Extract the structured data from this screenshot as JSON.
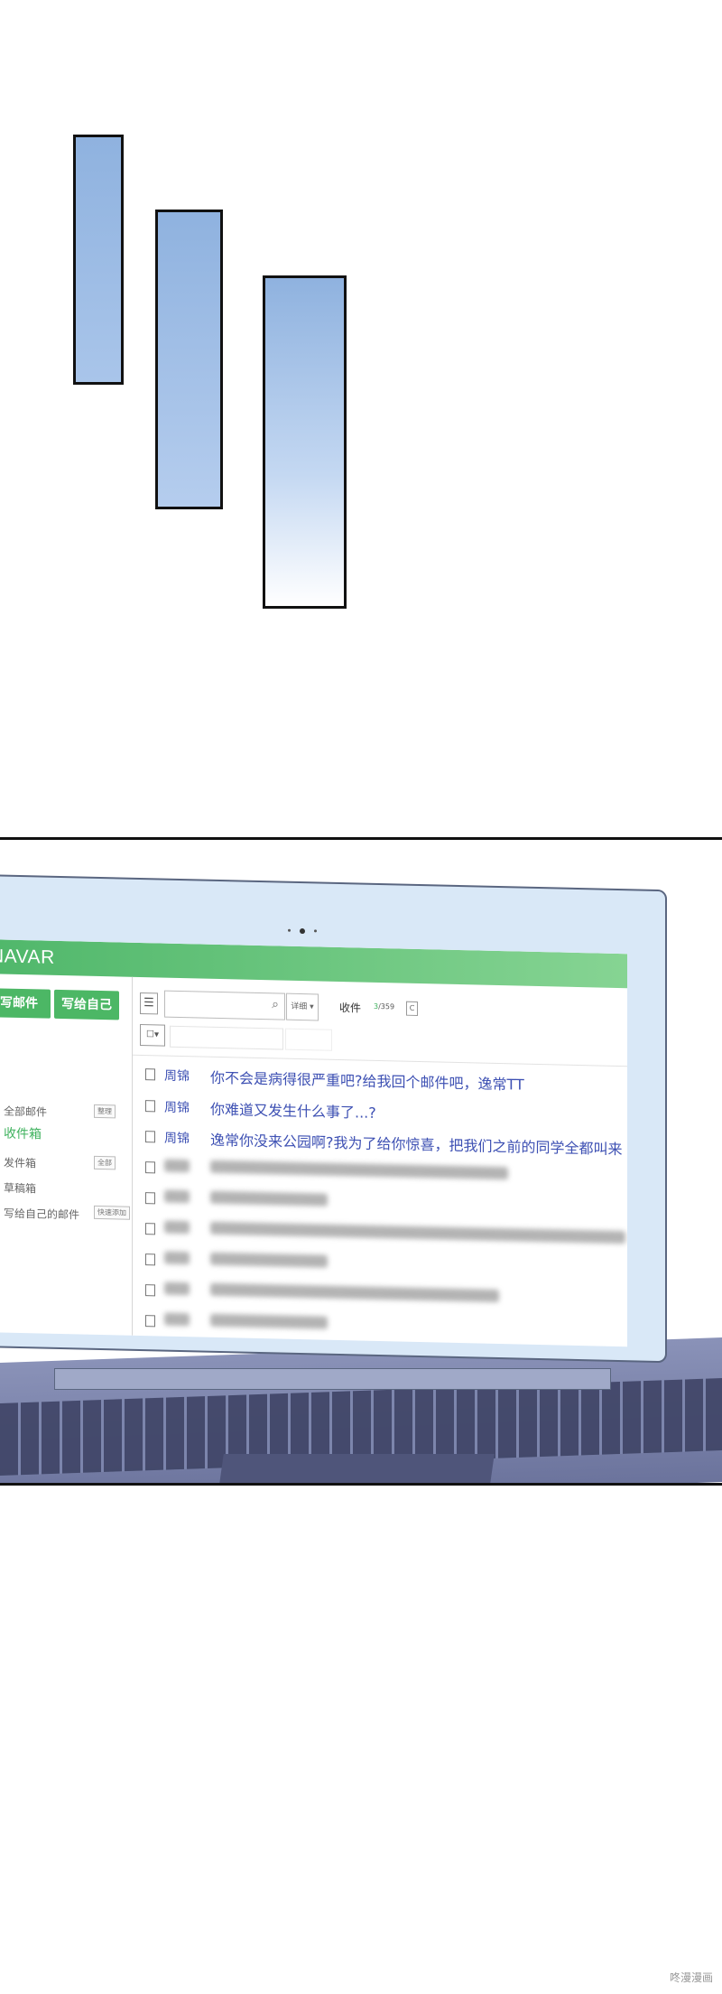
{
  "app": {
    "brand": "NAVAR"
  },
  "buttons": {
    "write": "写邮件",
    "write_self": "写给自己"
  },
  "sidebar": {
    "items": [
      {
        "label": "全部邮件",
        "tag": "整理"
      },
      {
        "label": "收件箱",
        "active": true
      },
      {
        "label": "发件箱",
        "tag": "全部"
      },
      {
        "label": "草稿箱"
      },
      {
        "label": "写给自己的邮件",
        "tag": "快速添加"
      }
    ]
  },
  "toolbar": {
    "search_option": "详细 ▾",
    "inbox_label": "收件",
    "unread": "3",
    "total": "/359"
  },
  "emails": [
    {
      "sender": "周锦",
      "subject": "你不会是病得很严重吧?给我回个邮件吧，逸常TT"
    },
    {
      "sender": "周锦",
      "subject": "你难道又发生什么事了...?"
    },
    {
      "sender": "周锦",
      "subject": "逸常你没来公园啊?我为了给你惊喜，把我们之前的同学全都叫来"
    }
  ],
  "colors": {
    "brand_green": "#4cb765",
    "link_blue": "#3d50b3"
  },
  "watermark": "咚漫漫画"
}
